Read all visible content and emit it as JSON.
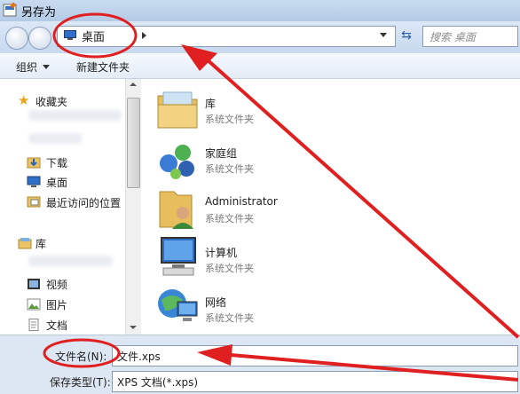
{
  "window": {
    "title": "另存为"
  },
  "address": {
    "location": "桌面",
    "search_placeholder": "搜索 桌面"
  },
  "toolbar": {
    "organize": "组织",
    "new_folder": "新建文件夹"
  },
  "sidebar": {
    "favorites": "收藏夹",
    "downloads": "下载",
    "desktop": "桌面",
    "recent": "最近访问的位置",
    "libraries": "库",
    "videos": "视频",
    "pictures": "图片",
    "documents": "文档"
  },
  "files": [
    {
      "name": "库",
      "type": "系统文件夹"
    },
    {
      "name": "家庭组",
      "type": "系统文件夹"
    },
    {
      "name": "Administrator",
      "type": "系统文件夹"
    },
    {
      "name": "计算机",
      "type": "系统文件夹"
    },
    {
      "name": "网络",
      "type": "系统文件夹"
    }
  ],
  "save": {
    "filename_label": "文件名(N):",
    "filename_value": "文件.xps",
    "filetype_label": "保存类型(T):",
    "filetype_value": "XPS 文档(*.xps)"
  },
  "annotations": {
    "color": "#e02020"
  }
}
